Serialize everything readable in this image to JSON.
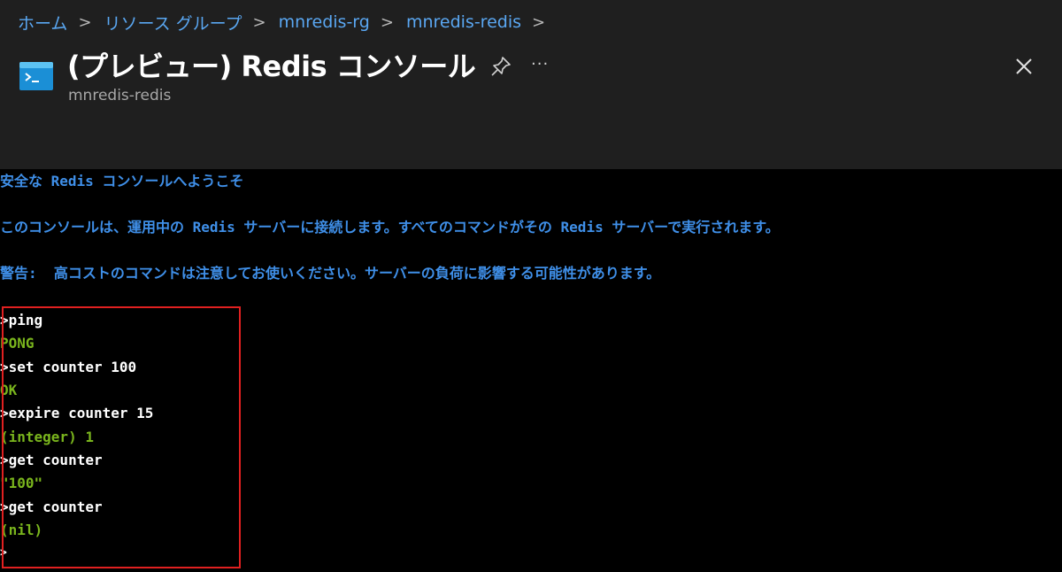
{
  "breadcrumb": {
    "items": [
      "ホーム",
      "リソース グループ",
      "mnredis-rg",
      "mnredis-redis"
    ],
    "separator": ">"
  },
  "header": {
    "title": "(プレビュー) Redis コンソール",
    "subtitle": "mnredis-redis",
    "more_label": "···",
    "icons": [
      "console-icon",
      "pin-icon",
      "more-icon",
      "close-icon"
    ]
  },
  "console": {
    "welcome": "安全な Redis コンソールへようこそ",
    "info": "このコンソールは、運用中の Redis サーバーに接続します。すべてのコマンドがその Redis サーバーで実行されます。",
    "warning": "警告:  高コストのコマンドは注意してお使いください。サーバーの負荷に影響する可能性があります。",
    "lines": [
      {
        "kind": "command",
        "text": ">ping"
      },
      {
        "kind": "output",
        "text": "PONG"
      },
      {
        "kind": "command",
        "text": ">set counter 100"
      },
      {
        "kind": "output",
        "text": "OK"
      },
      {
        "kind": "command",
        "text": ">expire counter 15"
      },
      {
        "kind": "output",
        "text": "(integer) 1"
      },
      {
        "kind": "command",
        "text": ">get counter"
      },
      {
        "kind": "output",
        "text": "\"100\""
      },
      {
        "kind": "command",
        "text": ">get counter"
      },
      {
        "kind": "output",
        "text": "(nil)"
      },
      {
        "kind": "prompt",
        "text": ">"
      }
    ]
  },
  "colors": {
    "header_bg": "#1f1f1f",
    "terminal_bg": "#000000",
    "link_blue": "#5aa7f2",
    "console_blue": "#3f8fe8",
    "command_white": "#ffffff",
    "output_green": "#7ab51d",
    "highlight_red": "#e02020"
  }
}
